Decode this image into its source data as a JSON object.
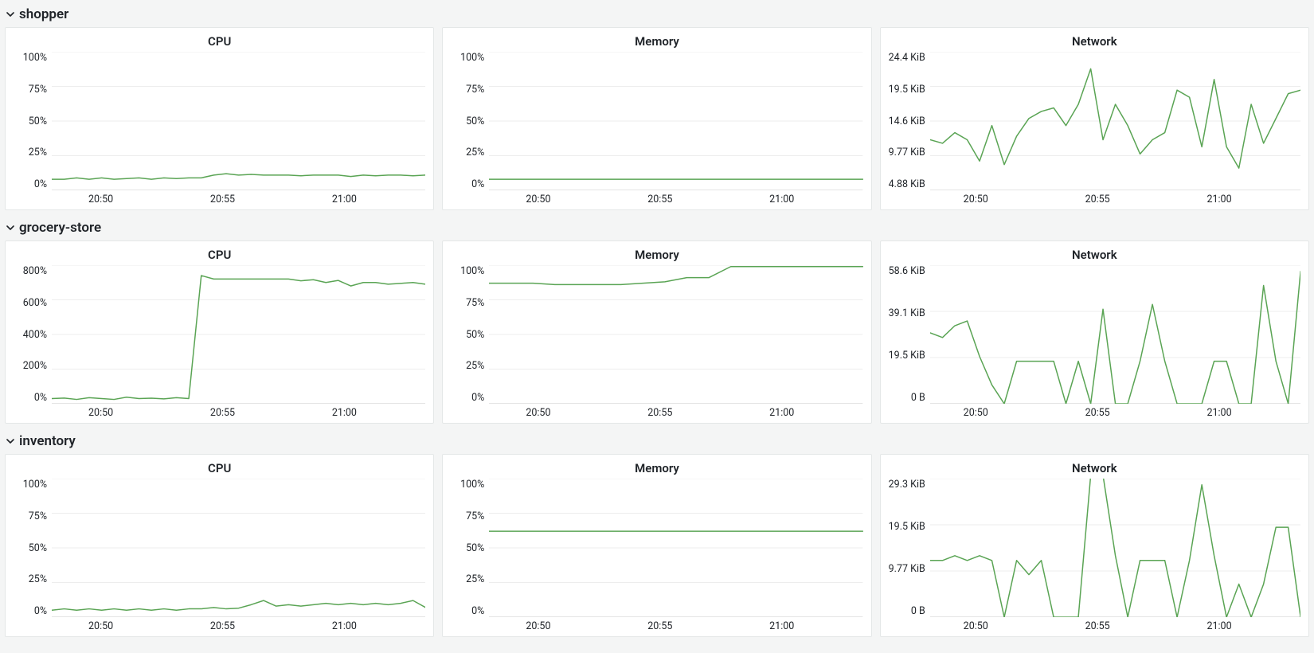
{
  "line_color": "#5aa454",
  "x_ticks": [
    "20:50",
    "20:55",
    "21:00"
  ],
  "x_tick_positions_pct": [
    12,
    45,
    78
  ],
  "sections": [
    {
      "name": "shopper"
    },
    {
      "name": "grocery-store"
    },
    {
      "name": "inventory"
    }
  ],
  "chart_data": [
    {
      "section": "shopper",
      "title": "CPU",
      "type": "line",
      "xlabel": "",
      "ylabel": "",
      "y_ticks": [
        "100%",
        "75%",
        "50%",
        "25%",
        "0%"
      ],
      "ylim": [
        0,
        100
      ],
      "x": [
        "20:49",
        "20:49.5",
        "20:50",
        "20:50.5",
        "20:51",
        "20:51.5",
        "20:52",
        "20:52.5",
        "20:53",
        "20:53.5",
        "20:54",
        "20:54.5",
        "20:55",
        "20:55.5",
        "20:56",
        "20:56.5",
        "20:57",
        "20:57.5",
        "20:58",
        "20:58.5",
        "20:59",
        "20:59.5",
        "21:00",
        "21:00.5",
        "21:01",
        "21:01.5",
        "21:02",
        "21:02.5",
        "21:03",
        "21:03.5",
        "21:04"
      ],
      "values": [
        8,
        8,
        9,
        8,
        9,
        8,
        8.5,
        9,
        8,
        9,
        8.5,
        9,
        9,
        11,
        12,
        11,
        11.5,
        11,
        11,
        11,
        10.5,
        11,
        11,
        11,
        10,
        11,
        10.5,
        11,
        11,
        10.5,
        11
      ]
    },
    {
      "section": "shopper",
      "title": "Memory",
      "type": "line",
      "xlabel": "",
      "ylabel": "",
      "y_ticks": [
        "100%",
        "75%",
        "50%",
        "25%",
        "0%"
      ],
      "ylim": [
        0,
        100
      ],
      "x": [
        "20:49",
        "20:50",
        "20:51",
        "20:52",
        "20:53",
        "20:54",
        "20:55",
        "20:56",
        "20:57",
        "20:58",
        "20:59",
        "21:00",
        "21:01",
        "21:02",
        "21:03",
        "21:04"
      ],
      "values": [
        8,
        8,
        8,
        8,
        8,
        8,
        8,
        8,
        8,
        8,
        8,
        8,
        8,
        8,
        8,
        8
      ]
    },
    {
      "section": "shopper",
      "title": "Network",
      "type": "line",
      "xlabel": "",
      "ylabel": "",
      "y_ticks": [
        "24.4 KiB",
        "19.5 KiB",
        "14.6 KiB",
        "9.77 KiB",
        "4.88 KiB"
      ],
      "ylim": [
        4.88,
        24.4
      ],
      "x": [
        "20:49",
        "20:49.5",
        "20:50",
        "20:50.5",
        "20:51",
        "20:51.5",
        "20:52",
        "20:52.5",
        "20:53",
        "20:53.5",
        "20:54",
        "20:54.5",
        "20:55",
        "20:55.5",
        "20:56",
        "20:56.5",
        "20:57",
        "20:57.5",
        "20:58",
        "20:58.5",
        "20:59",
        "20:59.5",
        "21:00",
        "21:00.5",
        "21:01",
        "21:01.5",
        "21:02",
        "21:02.5",
        "21:03",
        "21:03.5",
        "21:04"
      ],
      "values": [
        12.0,
        11.5,
        13.0,
        12.0,
        9.0,
        14.0,
        8.5,
        12.5,
        15.0,
        16.0,
        16.5,
        14.0,
        17.0,
        22.0,
        12.0,
        17.0,
        14.0,
        10.0,
        12.0,
        13.0,
        19.0,
        18.0,
        11.0,
        20.5,
        11.0,
        8.0,
        17.0,
        11.5,
        15.0,
        18.5,
        19.0
      ]
    },
    {
      "section": "grocery-store",
      "title": "CPU",
      "type": "line",
      "xlabel": "",
      "ylabel": "",
      "y_ticks": [
        "800%",
        "600%",
        "400%",
        "200%",
        "0%"
      ],
      "ylim": [
        0,
        800
      ],
      "x": [
        "20:49",
        "20:49.5",
        "20:50",
        "20:50.5",
        "20:51",
        "20:51.5",
        "20:52",
        "20:52.5",
        "20:53",
        "20:53.5",
        "20:54",
        "20:54.5",
        "20:55",
        "20:55.5",
        "20:56",
        "20:56.5",
        "20:57",
        "20:57.5",
        "20:58",
        "20:58.5",
        "20:59",
        "20:59.5",
        "21:00",
        "21:00.5",
        "21:01",
        "21:01.5",
        "21:02",
        "21:02.5",
        "21:03",
        "21:03.5",
        "21:04"
      ],
      "values": [
        30,
        33,
        25,
        35,
        30,
        25,
        38,
        30,
        32,
        28,
        35,
        30,
        740,
        720,
        720,
        720,
        720,
        720,
        720,
        720,
        710,
        716,
        700,
        712,
        680,
        700,
        700,
        690,
        695,
        700,
        690
      ]
    },
    {
      "section": "grocery-store",
      "title": "Memory",
      "type": "line",
      "xlabel": "",
      "ylabel": "",
      "y_ticks": [
        "100%",
        "75%",
        "50%",
        "25%",
        "0%"
      ],
      "ylim": [
        0,
        100
      ],
      "x": [
        "20:49",
        "20:50",
        "20:51",
        "20:52",
        "20:53",
        "20:54",
        "20:55",
        "20:55.5",
        "20:56",
        "20:56.5",
        "20:57",
        "20:58",
        "20:59",
        "21:00",
        "21:01",
        "21:02",
        "21:03",
        "21:04"
      ],
      "values": [
        87,
        87,
        87,
        86,
        86,
        86,
        86,
        87,
        88,
        91,
        91,
        99,
        99,
        99,
        99,
        99,
        99,
        99
      ]
    },
    {
      "section": "grocery-store",
      "title": "Network",
      "type": "line",
      "xlabel": "",
      "ylabel": "",
      "y_ticks": [
        "58.6 KiB",
        "39.1 KiB",
        "19.5 KiB",
        "0 B"
      ],
      "ylim": [
        0,
        58.6
      ],
      "x": [
        "20:49",
        "20:49.5",
        "20:50",
        "20:50.5",
        "20:51",
        "20:51.5",
        "20:52",
        "20:52.5",
        "20:53",
        "20:53.5",
        "20:54",
        "20:54.5",
        "20:55",
        "20:55.5",
        "20:56",
        "20:56.5",
        "20:57",
        "20:57.5",
        "20:58",
        "20:58.5",
        "20:59",
        "20:59.5",
        "21:00",
        "21:00.5",
        "21:01",
        "21:01.5",
        "21:02",
        "21:02.5",
        "21:03",
        "21:03.5",
        "21:04"
      ],
      "values": [
        30,
        28,
        33,
        35,
        20,
        8,
        0,
        18,
        18,
        18,
        18,
        0,
        18,
        0,
        40,
        0,
        0,
        18,
        42,
        18,
        0,
        0,
        0,
        18,
        18,
        0,
        0,
        50,
        18,
        0,
        56
      ]
    },
    {
      "section": "inventory",
      "title": "CPU",
      "type": "line",
      "xlabel": "",
      "ylabel": "",
      "y_ticks": [
        "100%",
        "75%",
        "50%",
        "25%",
        "0%"
      ],
      "ylim": [
        0,
        100
      ],
      "x": [
        "20:49",
        "20:49.5",
        "20:50",
        "20:50.5",
        "20:51",
        "20:51.5",
        "20:52",
        "20:52.5",
        "20:53",
        "20:53.5",
        "20:54",
        "20:54.5",
        "20:55",
        "20:55.5",
        "20:56",
        "20:56.5",
        "20:57",
        "20:57.5",
        "20:58",
        "20:58.5",
        "20:59",
        "20:59.5",
        "21:00",
        "21:00.5",
        "21:01",
        "21:01.5",
        "21:02",
        "21:02.5",
        "21:03",
        "21:03.5",
        "21:04"
      ],
      "values": [
        5,
        6,
        5,
        6,
        5,
        6,
        5,
        6,
        5,
        6,
        5,
        6,
        6,
        7,
        6,
        6.5,
        9,
        12,
        8,
        9,
        8,
        9,
        10,
        9,
        10,
        9,
        10,
        9,
        10,
        12,
        7
      ]
    },
    {
      "section": "inventory",
      "title": "Memory",
      "type": "line",
      "xlabel": "",
      "ylabel": "",
      "y_ticks": [
        "100%",
        "75%",
        "50%",
        "25%",
        "0%"
      ],
      "ylim": [
        0,
        100
      ],
      "x": [
        "20:49",
        "20:50",
        "20:51",
        "20:52",
        "20:53",
        "20:54",
        "20:55",
        "20:56",
        "20:57",
        "20:58",
        "20:59",
        "21:00",
        "21:01",
        "21:02",
        "21:03",
        "21:04"
      ],
      "values": [
        62,
        62,
        62,
        62,
        62,
        62,
        62,
        62,
        62,
        62,
        62,
        62,
        62,
        62,
        62,
        62
      ]
    },
    {
      "section": "inventory",
      "title": "Network",
      "type": "line",
      "xlabel": "",
      "ylabel": "",
      "y_ticks": [
        "29.3 KiB",
        "19.5 KiB",
        "9.77 KiB",
        "0 B"
      ],
      "ylim": [
        0,
        29.3
      ],
      "x": [
        "20:49",
        "20:49.5",
        "20:50",
        "20:50.5",
        "20:51",
        "20:51.5",
        "20:52",
        "20:52.5",
        "20:53",
        "20:53.5",
        "20:54",
        "20:54.5",
        "20:55",
        "20:55.5",
        "20:56",
        "20:56.5",
        "20:57",
        "20:57.5",
        "20:58",
        "20:58.5",
        "20:59",
        "20:59.5",
        "21:00",
        "21:00.5",
        "21:01",
        "21:01.5",
        "21:02",
        "21:02.5",
        "21:03",
        "21:03.5",
        "21:04"
      ],
      "values": [
        12,
        12,
        13,
        12,
        13,
        12,
        0,
        12,
        9,
        12,
        0,
        0,
        0,
        30,
        30,
        13,
        0,
        12,
        12,
        12,
        0,
        12,
        28,
        13,
        0,
        7,
        0,
        7,
        19,
        19,
        0
      ]
    }
  ]
}
